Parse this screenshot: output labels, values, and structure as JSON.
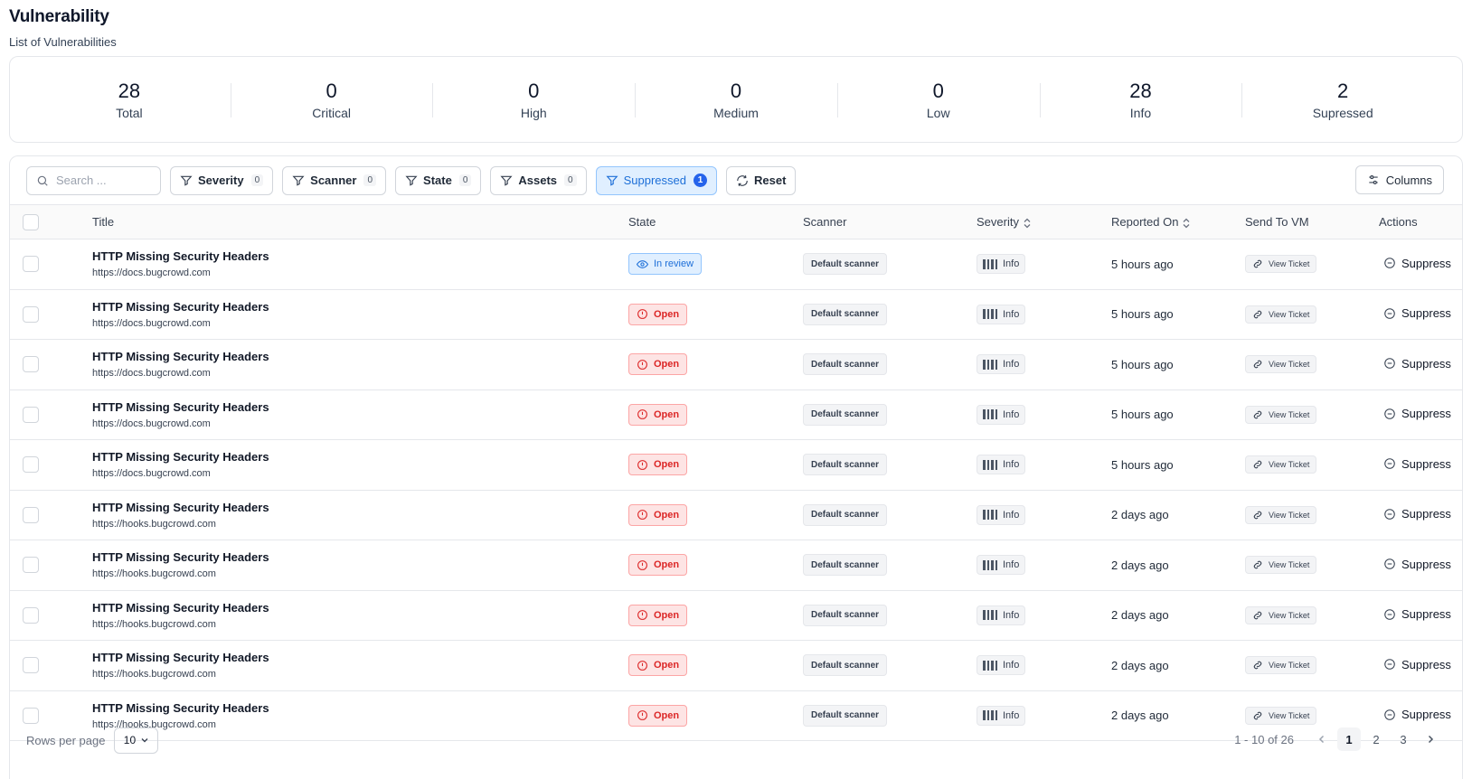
{
  "header": {
    "title": "Vulnerability",
    "subtitle": "List of Vulnerabilities"
  },
  "stats": [
    {
      "value": "28",
      "label": "Total"
    },
    {
      "value": "0",
      "label": "Critical"
    },
    {
      "value": "0",
      "label": "High"
    },
    {
      "value": "0",
      "label": "Medium"
    },
    {
      "value": "0",
      "label": "Low"
    },
    {
      "value": "28",
      "label": "Info"
    },
    {
      "value": "2",
      "label": "Supressed"
    }
  ],
  "toolbar": {
    "search_placeholder": "Search ...",
    "filters": [
      {
        "label": "Severity",
        "count": "0"
      },
      {
        "label": "Scanner",
        "count": "0"
      },
      {
        "label": "State",
        "count": "0"
      },
      {
        "label": "Assets",
        "count": "0"
      },
      {
        "label": "Suppressed",
        "count": "1",
        "active": true
      }
    ],
    "reset_label": "Reset",
    "columns_label": "Columns"
  },
  "columns": {
    "title": "Title",
    "state": "State",
    "scanner": "Scanner",
    "severity": "Severity",
    "reported_on": "Reported On",
    "send_to_vm": "Send To VM",
    "actions": "Actions"
  },
  "rows": [
    {
      "title": "HTTP Missing Security Headers",
      "url": "https://docs.bugcrowd.com",
      "state": "In review",
      "state_type": "review",
      "scanner": "Default scanner",
      "severity": "Info",
      "reported": "5 hours ago",
      "ticket": "View Ticket",
      "action": "Suppress"
    },
    {
      "title": "HTTP Missing Security Headers",
      "url": "https://docs.bugcrowd.com",
      "state": "Open",
      "state_type": "open",
      "scanner": "Default scanner",
      "severity": "Info",
      "reported": "5 hours ago",
      "ticket": "View Ticket",
      "action": "Suppress"
    },
    {
      "title": "HTTP Missing Security Headers",
      "url": "https://docs.bugcrowd.com",
      "state": "Open",
      "state_type": "open",
      "scanner": "Default scanner",
      "severity": "Info",
      "reported": "5 hours ago",
      "ticket": "View Ticket",
      "action": "Suppress"
    },
    {
      "title": "HTTP Missing Security Headers",
      "url": "https://docs.bugcrowd.com",
      "state": "Open",
      "state_type": "open",
      "scanner": "Default scanner",
      "severity": "Info",
      "reported": "5 hours ago",
      "ticket": "View Ticket",
      "action": "Suppress"
    },
    {
      "title": "HTTP Missing Security Headers",
      "url": "https://docs.bugcrowd.com",
      "state": "Open",
      "state_type": "open",
      "scanner": "Default scanner",
      "severity": "Info",
      "reported": "5 hours ago",
      "ticket": "View Ticket",
      "action": "Suppress"
    },
    {
      "title": "HTTP Missing Security Headers",
      "url": "https://hooks.bugcrowd.com",
      "state": "Open",
      "state_type": "open",
      "scanner": "Default scanner",
      "severity": "Info",
      "reported": "2 days ago",
      "ticket": "View Ticket",
      "action": "Suppress"
    },
    {
      "title": "HTTP Missing Security Headers",
      "url": "https://hooks.bugcrowd.com",
      "state": "Open",
      "state_type": "open",
      "scanner": "Default scanner",
      "severity": "Info",
      "reported": "2 days ago",
      "ticket": "View Ticket",
      "action": "Suppress"
    },
    {
      "title": "HTTP Missing Security Headers",
      "url": "https://hooks.bugcrowd.com",
      "state": "Open",
      "state_type": "open",
      "scanner": "Default scanner",
      "severity": "Info",
      "reported": "2 days ago",
      "ticket": "View Ticket",
      "action": "Suppress"
    },
    {
      "title": "HTTP Missing Security Headers",
      "url": "https://hooks.bugcrowd.com",
      "state": "Open",
      "state_type": "open",
      "scanner": "Default scanner",
      "severity": "Info",
      "reported": "2 days ago",
      "ticket": "View Ticket",
      "action": "Suppress"
    },
    {
      "title": "HTTP Missing Security Headers",
      "url": "https://hooks.bugcrowd.com",
      "state": "Open",
      "state_type": "open",
      "scanner": "Default scanner",
      "severity": "Info",
      "reported": "2 days ago",
      "ticket": "View Ticket",
      "action": "Suppress"
    }
  ],
  "footer": {
    "rows_per_page_label": "Rows per page",
    "rows_per_page_value": "10",
    "range": "1 - 10 of 26",
    "pages": [
      "1",
      "2",
      "3"
    ],
    "current_page": "1"
  },
  "icons": {
    "search": "search-icon",
    "filter": "filter-icon",
    "reset": "refresh-icon",
    "columns": "sliders-icon",
    "review": "eye-icon",
    "open": "alert-circle-icon",
    "severity": "severity-bars-icon",
    "ticket": "link-icon",
    "suppress": "minus-circle-icon",
    "sort": "sort-icon"
  },
  "colors": {
    "accent": "#1d6fd8",
    "open_red": "#dc2626",
    "review_bg": "#e0efff",
    "open_bg": "#fde4e4"
  }
}
